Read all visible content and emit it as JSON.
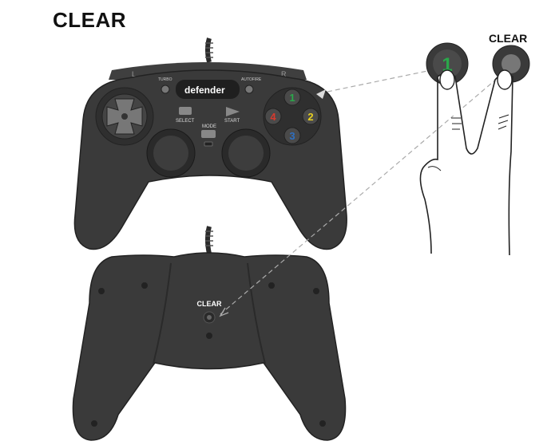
{
  "title": "CLEAR",
  "brand": "defender",
  "shoulders": {
    "left": "L",
    "right": "R"
  },
  "buttons": {
    "turbo": "TURBO",
    "autofire": "AUTOFIRE",
    "select": "SELECT",
    "start": "START",
    "mode": "MODE"
  },
  "face_buttons": [
    {
      "label": "1",
      "color": "#2aa84a"
    },
    {
      "label": "2",
      "color": "#e8d020"
    },
    {
      "label": "3",
      "color": "#2f6fc0"
    },
    {
      "label": "4",
      "color": "#d63a2e"
    }
  ],
  "back_clear_label": "CLEAR",
  "hand_clear_label": "CLEAR",
  "hand_button_label": "1",
  "colors": {
    "pad_body": "#3a3a3a",
    "pad_dark": "#2b2b2b",
    "line": "#9a9a9a"
  }
}
